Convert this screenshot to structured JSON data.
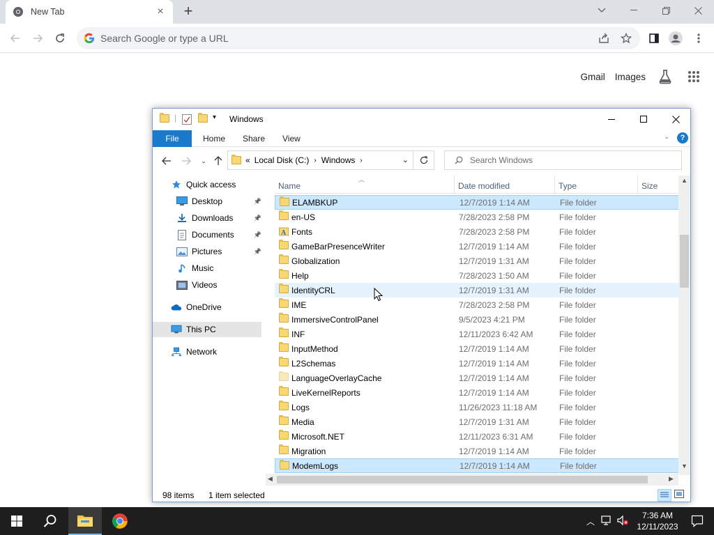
{
  "chrome": {
    "tab_title": "New Tab",
    "omnibox_placeholder": "Search Google or type a URL",
    "ntp_links": [
      "Gmail",
      "Images"
    ]
  },
  "explorer": {
    "window_title": "Windows",
    "ribbon_tabs": [
      "File",
      "Home",
      "Share",
      "View"
    ],
    "breadcrumb": {
      "prefix": "«",
      "parts": [
        "Local Disk (C:)",
        "Windows"
      ]
    },
    "search_placeholder": "Search Windows",
    "nav_items": [
      {
        "label": "Quick access",
        "icon": "star-icon",
        "pinned": false
      },
      {
        "label": "Desktop",
        "icon": "desktop-icon",
        "pinned": true
      },
      {
        "label": "Downloads",
        "icon": "downloads-icon",
        "pinned": true
      },
      {
        "label": "Documents",
        "icon": "documents-icon",
        "pinned": true
      },
      {
        "label": "Pictures",
        "icon": "pictures-icon",
        "pinned": true
      },
      {
        "label": "Music",
        "icon": "music-icon",
        "pinned": false
      },
      {
        "label": "Videos",
        "icon": "videos-icon",
        "pinned": false
      },
      {
        "label": "OneDrive",
        "icon": "onedrive-icon",
        "pinned": false
      },
      {
        "label": "This PC",
        "icon": "this-pc-icon",
        "pinned": false,
        "selected": true
      },
      {
        "label": "Network",
        "icon": "network-icon",
        "pinned": false
      }
    ],
    "columns": [
      "Name",
      "Date modified",
      "Type",
      "Size"
    ],
    "rows": [
      {
        "name": "ELAMBKUP",
        "date": "12/7/2019 1:14 AM",
        "type": "File folder",
        "state": "selected"
      },
      {
        "name": "en-US",
        "date": "7/28/2023 2:58 PM",
        "type": "File folder"
      },
      {
        "name": "Fonts",
        "date": "7/28/2023 2:58 PM",
        "type": "File folder",
        "icon": "fonts"
      },
      {
        "name": "GameBarPresenceWriter",
        "date": "12/7/2019 1:14 AM",
        "type": "File folder"
      },
      {
        "name": "Globalization",
        "date": "12/7/2019 1:31 AM",
        "type": "File folder"
      },
      {
        "name": "Help",
        "date": "7/28/2023 1:50 AM",
        "type": "File folder"
      },
      {
        "name": "IdentityCRL",
        "date": "12/7/2019 1:31 AM",
        "type": "File folder",
        "state": "hover"
      },
      {
        "name": "IME",
        "date": "7/28/2023 2:58 PM",
        "type": "File folder"
      },
      {
        "name": "ImmersiveControlPanel",
        "date": "9/5/2023 4:21 PM",
        "type": "File folder"
      },
      {
        "name": "INF",
        "date": "12/11/2023 6:42 AM",
        "type": "File folder"
      },
      {
        "name": "InputMethod",
        "date": "12/7/2019 1:14 AM",
        "type": "File folder"
      },
      {
        "name": "L2Schemas",
        "date": "12/7/2019 1:14 AM",
        "type": "File folder"
      },
      {
        "name": "LanguageOverlayCache",
        "date": "12/7/2019 1:14 AM",
        "type": "File folder"
      },
      {
        "name": "LiveKernelReports",
        "date": "12/7/2019 1:14 AM",
        "type": "File folder"
      },
      {
        "name": "Logs",
        "date": "11/26/2023 11:18 AM",
        "type": "File folder"
      },
      {
        "name": "Media",
        "date": "12/7/2019 1:31 AM",
        "type": "File folder"
      },
      {
        "name": "Microsoft.NET",
        "date": "12/11/2023 6:31 AM",
        "type": "File folder"
      },
      {
        "name": "Migration",
        "date": "12/7/2019 1:14 AM",
        "type": "File folder"
      },
      {
        "name": "ModemLogs",
        "date": "12/7/2019 1:14 AM",
        "type": "File folder",
        "state": "selected"
      }
    ],
    "status": {
      "count": "98 items",
      "selection": "1 item selected"
    }
  },
  "taskbar": {
    "time": "7:36 AM",
    "date": "12/11/2023"
  },
  "colors": {
    "accent": "#1979ca",
    "selection_bg": "#cce8ff",
    "hover_bg": "#e5f3ff",
    "folder": "#f8d775",
    "taskbar": "#1e1e1e"
  }
}
